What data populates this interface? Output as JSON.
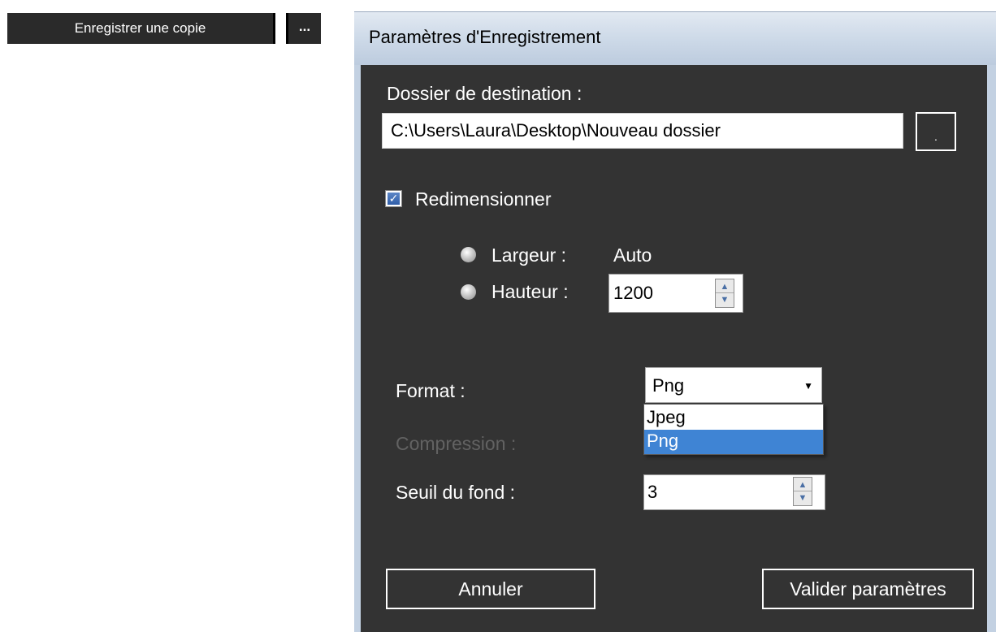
{
  "toolbar": {
    "save_copy_label": "Enregistrer une copie",
    "more_label": "..."
  },
  "dialog": {
    "title": "Paramètres d'Enregistrement",
    "destination_label": "Dossier de destination :",
    "destination_value": "C:\\Users\\Laura\\Desktop\\Nouveau dossier",
    "browse_label": ".",
    "resize_label": "Redimensionner",
    "resize_checked": true,
    "width_label": "Largeur :",
    "width_value": "Auto",
    "height_label": "Hauteur :",
    "height_value": "1200",
    "format_label": "Format :",
    "format_value": "Png",
    "format_options": [
      "Jpeg",
      "Png"
    ],
    "compression_label": "Compression :",
    "threshold_label": "Seuil du fond :",
    "threshold_value": "3",
    "cancel_label": "Annuler",
    "validate_label": "Valider paramètres"
  },
  "colors": {
    "dialog_bg": "#333333",
    "selected_option": "#3f84d4",
    "titlebar": "#cfdbe9"
  }
}
